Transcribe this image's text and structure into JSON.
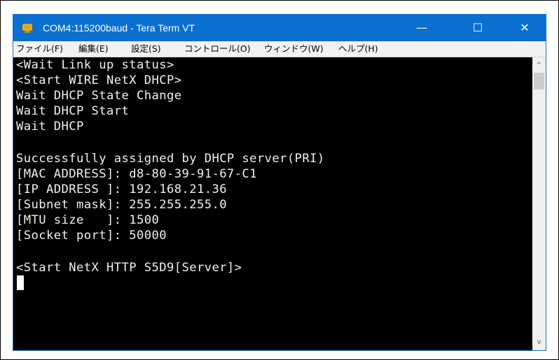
{
  "window": {
    "title": "COM4:115200baud - Tera Term VT",
    "minimize_glyph": "—",
    "maximize_glyph": "☐",
    "close_glyph": "✕",
    "icon": "tera-term-app-icon"
  },
  "menu": {
    "items": [
      {
        "label": "ファイル(F)"
      },
      {
        "label": "編集(E)"
      },
      {
        "label": "設定(S)"
      },
      {
        "label": "コントロール(O)"
      },
      {
        "label": "ウィンドウ(W)"
      },
      {
        "label": "ヘルプ(H)"
      }
    ]
  },
  "terminal": {
    "lines": [
      "<Wait Link up status>",
      "<Start WIRE NetX DHCP>",
      "Wait DHCP State Change",
      "Wait DHCP Start",
      "Wait DHCP",
      "",
      "Successfully assigned by DHCP server(PRI)",
      "[MAC ADDRESS]: d8-80-39-91-67-C1",
      "[IP ADDRESS ]: 192.168.21.36",
      "[Subnet mask]: 255.255.255.0",
      "[MTU size   ]: 1500",
      "[Socket port]: 50000",
      "",
      "<Start NetX HTTP S5D9[Server]>"
    ]
  },
  "scrollbar": {
    "up_glyph": "^",
    "down_glyph": "v"
  },
  "colors": {
    "titlebar": "#0b6fd0",
    "terminal_bg": "#000000",
    "terminal_fg": "#f0f0f0"
  }
}
